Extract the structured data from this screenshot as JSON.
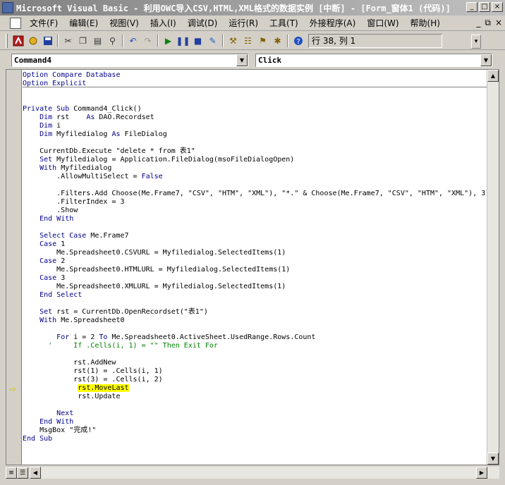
{
  "window": {
    "title": "Microsoft Visual Basic - 利用OWC导入CSV,HTML,XML格式的数据实例 [中断] - [Form_窗体1 (代码)]",
    "controls": [
      "_",
      "□",
      "×"
    ]
  },
  "menu": {
    "items": [
      "文件(F)",
      "编辑(E)",
      "视图(V)",
      "插入(I)",
      "调试(D)",
      "运行(R)",
      "工具(T)",
      "外接程序(A)",
      "窗口(W)",
      "帮助(H)"
    ],
    "right": [
      "_",
      "⧉",
      "×"
    ]
  },
  "toolbar": {
    "position_text": "行 38, 列 1"
  },
  "object_dropdown": {
    "value": "Command4"
  },
  "procedure_dropdown": {
    "value": "Click"
  },
  "code_lines": [
    {
      "text": "Option Compare Database",
      "cls": "kw"
    },
    {
      "text": "Option Explicit",
      "cls": "kw"
    },
    {
      "text": "",
      "cls": ""
    },
    {
      "text": "",
      "cls": ""
    },
    {
      "text": "Private Sub Command4_Click()",
      "cls": ""
    },
    {
      "text": "    Dim rst    As DAO.Recordset",
      "cls": ""
    },
    {
      "text": "    Dim i",
      "cls": ""
    },
    {
      "text": "    Dim Myfiledialog As FileDialog",
      "cls": ""
    },
    {
      "text": "",
      "cls": ""
    },
    {
      "text": "    CurrentDb.Execute \"delete * from 表1\"",
      "cls": ""
    },
    {
      "text": "    Set Myfiledialog = Application.FileDialog(msoFileDialogOpen)",
      "cls": ""
    },
    {
      "text": "    With Myfiledialog",
      "cls": ""
    },
    {
      "text": "        .AllowMultiSelect = False",
      "cls": ""
    },
    {
      "text": "",
      "cls": ""
    },
    {
      "text": "        .Filters.Add Choose(Me.Frame7, \"CSV\", \"HTM\", \"XML\"), \"*.\" & Choose(Me.Frame7, \"CSV\", \"HTM\", \"XML\"), 3",
      "cls": ""
    },
    {
      "text": "        .FilterIndex = 3",
      "cls": ""
    },
    {
      "text": "        .Show",
      "cls": ""
    },
    {
      "text": "    End With",
      "cls": ""
    },
    {
      "text": "",
      "cls": ""
    },
    {
      "text": "    Select Case Me.Frame7",
      "cls": ""
    },
    {
      "text": "    Case 1",
      "cls": ""
    },
    {
      "text": "        Me.Spreadsheet0.CSVURL = Myfiledialog.SelectedItems(1)",
      "cls": ""
    },
    {
      "text": "    Case 2",
      "cls": ""
    },
    {
      "text": "        Me.Spreadsheet0.HTMLURL = Myfiledialog.SelectedItems(1)",
      "cls": ""
    },
    {
      "text": "    Case 3",
      "cls": ""
    },
    {
      "text": "        Me.Spreadsheet0.XMLURL = Myfiledialog.SelectedItems(1)",
      "cls": ""
    },
    {
      "text": "    End Select",
      "cls": ""
    },
    {
      "text": "",
      "cls": ""
    },
    {
      "text": "    Set rst = CurrentDb.OpenRecordset(\"表1\")",
      "cls": ""
    },
    {
      "text": "    With Me.Spreadsheet0",
      "cls": ""
    },
    {
      "text": "",
      "cls": ""
    },
    {
      "text": "        For i = 2 To Me.Spreadsheet0.ActiveSheet.UsedRange.Rows.Count",
      "cls": ""
    },
    {
      "text": "      '     If .Cells(i, 1) = \"\" Then Exit For",
      "cls": "cm"
    },
    {
      "text": "",
      "cls": ""
    },
    {
      "text": "            rst.AddNew",
      "cls": ""
    },
    {
      "text": "            rst(1) = .Cells(i, 1)",
      "cls": ""
    },
    {
      "text": "            rst(3) = .Cells(i, 2)",
      "cls": ""
    },
    {
      "text": "             rst.MoveLast",
      "cls": "hl"
    },
    {
      "text": "             rst.Update",
      "cls": ""
    },
    {
      "text": "",
      "cls": ""
    },
    {
      "text": "        Next",
      "cls": ""
    },
    {
      "text": "    End With",
      "cls": ""
    },
    {
      "text": "    MsgBox \"完成!\"",
      "cls": ""
    },
    {
      "text": "End Sub",
      "cls": ""
    }
  ]
}
